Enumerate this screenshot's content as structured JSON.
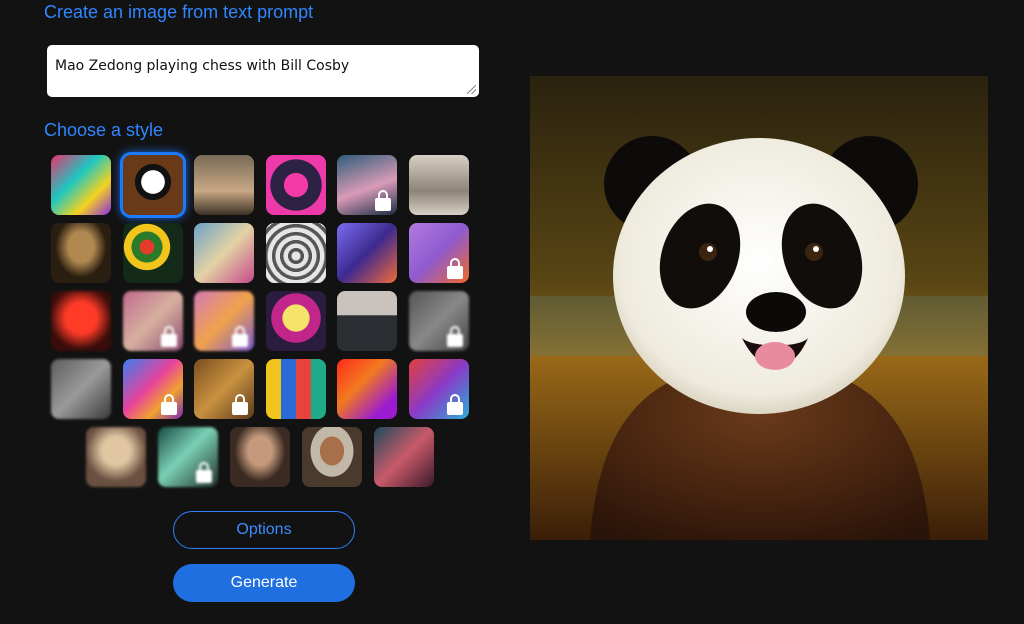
{
  "header": {
    "title": "Create an image from text prompt"
  },
  "prompt": {
    "value": "Mao Zedong playing chess with Bill Cosby"
  },
  "style_section": {
    "title": "Choose a style",
    "selected_index": 1,
    "styles": [
      {
        "name": "style-abstract-paint",
        "locked": false
      },
      {
        "name": "style-panda",
        "locked": false
      },
      {
        "name": "style-landscape-painting",
        "locked": false
      },
      {
        "name": "style-robot",
        "locked": false
      },
      {
        "name": "style-anime-portrait",
        "locked": true
      },
      {
        "name": "style-engraving",
        "locked": false
      },
      {
        "name": "style-renaissance",
        "locked": false
      },
      {
        "name": "style-folk-flowers",
        "locked": false
      },
      {
        "name": "style-ballet",
        "locked": false
      },
      {
        "name": "style-metal-object",
        "locked": false
      },
      {
        "name": "style-isometric",
        "locked": false
      },
      {
        "name": "style-fox-cartoon",
        "locked": true
      },
      {
        "name": "style-neon-figure",
        "locked": false
      },
      {
        "name": "style-pastel-portrait",
        "locked": true
      },
      {
        "name": "style-dreamy-fantasy",
        "locked": true
      },
      {
        "name": "style-pop-art",
        "locked": false
      },
      {
        "name": "style-architecture",
        "locked": false
      },
      {
        "name": "style-dark-sketch",
        "locked": true
      },
      {
        "name": "style-gray-texture",
        "locked": false
      },
      {
        "name": "style-psychedelic",
        "locked": true
      },
      {
        "name": "style-oil-bronze",
        "locked": true
      },
      {
        "name": "style-icon-pattern",
        "locked": false
      },
      {
        "name": "style-red-abstract",
        "locked": false
      },
      {
        "name": "style-glitch-portrait",
        "locked": true
      },
      {
        "name": "style-fantasy-elf",
        "locked": false
      },
      {
        "name": "style-teal-mist",
        "locked": true
      },
      {
        "name": "style-classical-portrait",
        "locked": false
      },
      {
        "name": "style-pirate-painting",
        "locked": false
      },
      {
        "name": "style-dark-portrait",
        "locked": false
      }
    ]
  },
  "buttons": {
    "options_label": "Options",
    "generate_label": "Generate"
  },
  "result": {
    "subject": "panda"
  },
  "colors": {
    "accent": "#2f86ff",
    "background": "#121212",
    "generate_bg": "#1f6fe0"
  }
}
